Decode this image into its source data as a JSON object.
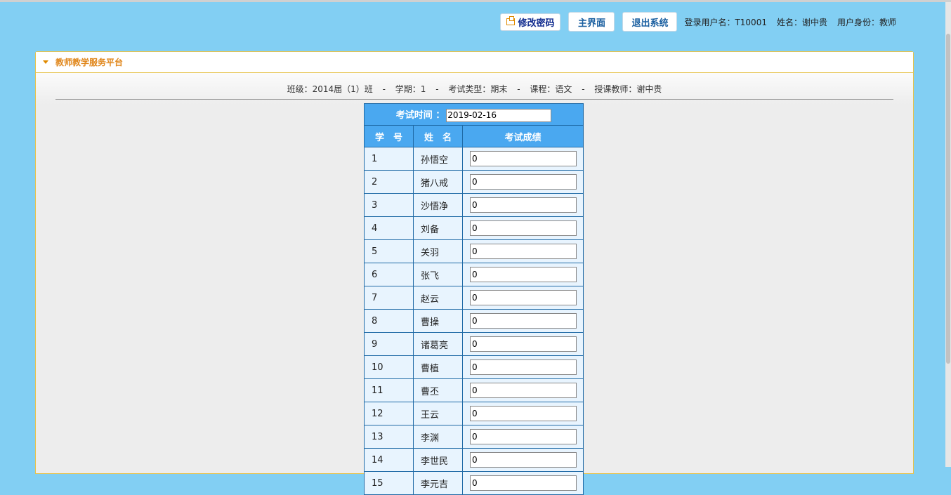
{
  "header": {
    "change_password": "修改密码",
    "main_page": "主界面",
    "logout": "退出系统",
    "login_user": "登录用户名：T10001",
    "name": "姓名：谢中贵",
    "role": "用户身份：教师"
  },
  "panel": {
    "title": "教师教学服务平台",
    "info": {
      "class": "班级：2014届（1）班",
      "term": "学期：1",
      "exam_type": "考试类型：期末",
      "course": "课程：语文",
      "teacher": "授课教师：谢中贵",
      "separator": "-"
    }
  },
  "table": {
    "exam_time_label": "考试时间 ：",
    "exam_time_value": "2019-02-16",
    "col_id": "学　号",
    "col_name": "姓　名",
    "col_score": "考试成绩",
    "rows": [
      {
        "id": "1",
        "name": "孙悟空",
        "score": "0"
      },
      {
        "id": "2",
        "name": "猪八戒",
        "score": "0"
      },
      {
        "id": "3",
        "name": "沙悟净",
        "score": "0"
      },
      {
        "id": "4",
        "name": "刘备",
        "score": "0"
      },
      {
        "id": "5",
        "name": "关羽",
        "score": "0"
      },
      {
        "id": "6",
        "name": "张飞",
        "score": "0"
      },
      {
        "id": "7",
        "name": "赵云",
        "score": "0"
      },
      {
        "id": "8",
        "name": "曹操",
        "score": "0"
      },
      {
        "id": "9",
        "name": "诸葛亮",
        "score": "0"
      },
      {
        "id": "10",
        "name": "曹植",
        "score": "0"
      },
      {
        "id": "11",
        "name": "曹丕",
        "score": "0"
      },
      {
        "id": "12",
        "name": "王云",
        "score": "0"
      },
      {
        "id": "13",
        "name": "李渊",
        "score": "0"
      },
      {
        "id": "14",
        "name": "李世民",
        "score": "0"
      },
      {
        "id": "15",
        "name": "李元吉",
        "score": "0"
      }
    ]
  }
}
